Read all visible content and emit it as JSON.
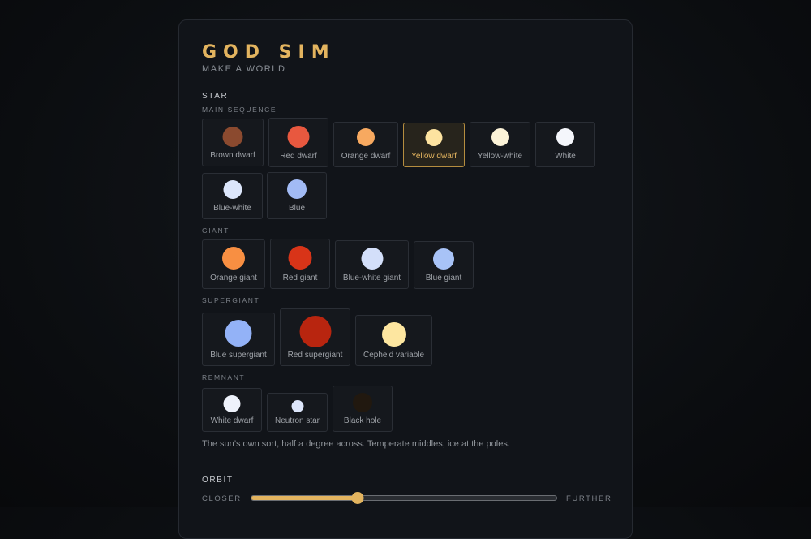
{
  "header": {
    "title": "GOD SIM",
    "subtitle": "MAKE A WORLD"
  },
  "star": {
    "section_label": "STAR",
    "groups": [
      {
        "label": "MAIN SEQUENCE",
        "items": [
          {
            "label": "Brown dwarf",
            "color": "#8b4a2f",
            "selected": false
          },
          {
            "label": "Red dwarf",
            "color": "#e8583f",
            "selected": false
          },
          {
            "label": "Orange dwarf",
            "color": "#f7a960",
            "selected": false
          },
          {
            "label": "Yellow dwarf",
            "color": "#fde3a0",
            "selected": true
          },
          {
            "label": "Yellow-white",
            "color": "#fcf3d8",
            "selected": false
          },
          {
            "label": "White",
            "color": "#f4f6fb",
            "selected": false
          },
          {
            "label": "Blue-white",
            "color": "#dce6fb",
            "selected": false
          },
          {
            "label": "Blue",
            "color": "#a2bbf5",
            "selected": false
          }
        ]
      },
      {
        "label": "GIANT",
        "items": [
          {
            "label": "Orange giant",
            "color": "#f88f42",
            "selected": false
          },
          {
            "label": "Red giant",
            "color": "#d83418",
            "selected": false
          },
          {
            "label": "Blue-white giant",
            "color": "#d3dffa",
            "selected": false
          },
          {
            "label": "Blue giant",
            "color": "#a8c3f7",
            "selected": false
          }
        ]
      },
      {
        "label": "SUPERGIANT",
        "items": [
          {
            "label": "Blue supergiant",
            "color": "#93b2f7",
            "selected": false
          },
          {
            "label": "Red supergiant",
            "color": "#b8250f",
            "selected": false
          },
          {
            "label": "Cepheid variable",
            "color": "#fde6a0",
            "selected": false
          }
        ]
      },
      {
        "label": "REMNANT",
        "items": [
          {
            "label": "White dwarf",
            "color": "#eef2fb",
            "selected": false
          },
          {
            "label": "Neutron star",
            "color": "#dde6fb",
            "selected": false
          },
          {
            "label": "Black hole",
            "color": "#21180f",
            "selected": false
          }
        ]
      }
    ],
    "description": "The sun’s own sort, half a degree across. Temperate middles, ice at the poles."
  },
  "orbit": {
    "section_label": "ORBIT",
    "min_label": "CLOSER",
    "max_label": "FURTHER",
    "value_fraction": 0.35
  },
  "colors": {
    "accent": "#e3b45f"
  }
}
